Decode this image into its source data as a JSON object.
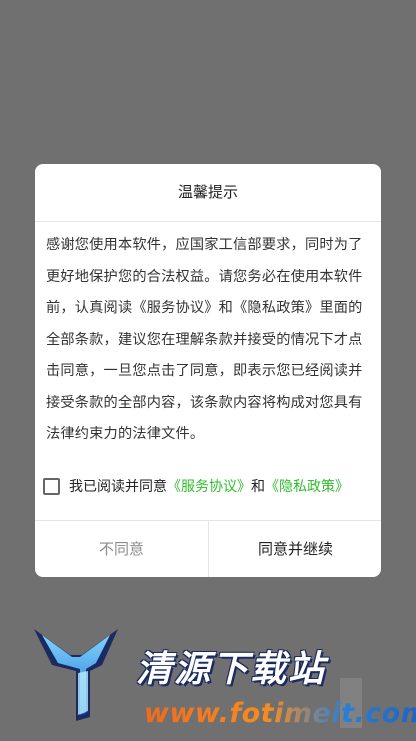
{
  "dialog": {
    "title": "温馨提示",
    "body": "感谢您使用本软件，应国家工信部要求，同时为了更好地保护您的合法权益。请您务必在使用本软件前，认真阅读《服务协议》和《隐私政策》里面的全部条款，建议您在理解条款并接受的情况下才点击同意，一旦您点击了同意，即表示您已经阅读并接受条款的全部内容，该条款内容将构成对您具有法律约束力的法律文件。",
    "agree_prefix": "我已阅读并同意",
    "service_link": "《服务协议》",
    "and_text": "和",
    "privacy_link": "《隐私政策》",
    "agree_checked": false,
    "disagree_label": "不同意",
    "agree_label": "同意并继续"
  },
  "watermark": {
    "name": "清源下载站",
    "url": "www.fotimeit.com"
  },
  "colors": {
    "link": "#2fbd2f",
    "overlay": "#707070",
    "disagree_text": "#8c8c8c"
  }
}
